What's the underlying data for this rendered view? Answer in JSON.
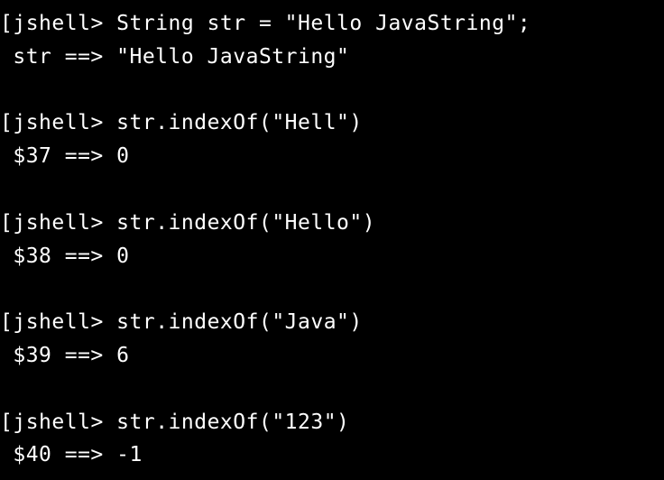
{
  "terminal": {
    "lines": [
      {
        "type": "prompt",
        "prompt": "jshell>",
        "command": "String str = \"Hello JavaString\";"
      },
      {
        "type": "output",
        "text": " str ==> \"Hello JavaString\""
      },
      {
        "type": "blank"
      },
      {
        "type": "prompt",
        "prompt": "jshell>",
        "command": "str.indexOf(\"Hell\")"
      },
      {
        "type": "output",
        "text": " $37 ==> 0"
      },
      {
        "type": "blank"
      },
      {
        "type": "prompt",
        "prompt": "jshell>",
        "command": "str.indexOf(\"Hello\")"
      },
      {
        "type": "output",
        "text": " $38 ==> 0"
      },
      {
        "type": "blank"
      },
      {
        "type": "prompt",
        "prompt": "jshell>",
        "command": "str.indexOf(\"Java\")"
      },
      {
        "type": "output",
        "text": " $39 ==> 6"
      },
      {
        "type": "blank"
      },
      {
        "type": "prompt",
        "prompt": "jshell>",
        "command": "str.indexOf(\"123\")"
      },
      {
        "type": "output",
        "text": " $40 ==> -1"
      }
    ]
  }
}
